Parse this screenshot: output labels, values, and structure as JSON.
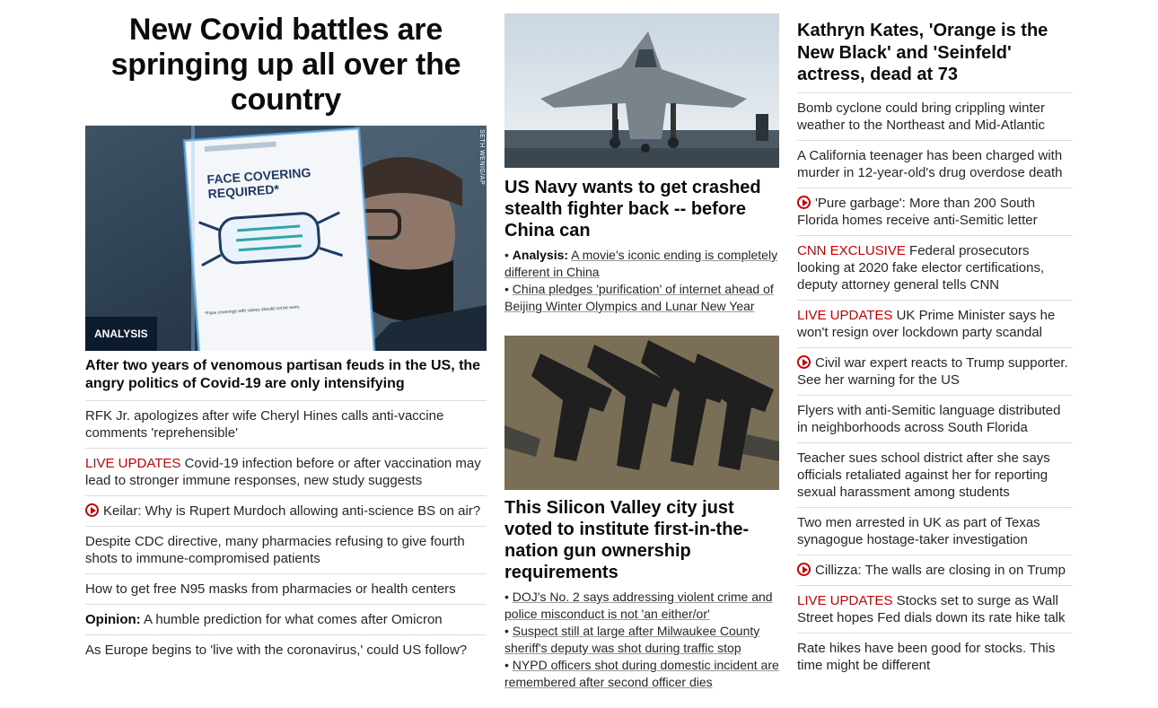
{
  "col1": {
    "title": "New Covid battles are springing up all over the country",
    "badge": "ANALYSIS",
    "credit": "SETH WENIG/AP",
    "sign_line1": "FACE COVERING",
    "sign_line2": "REQUIRED*",
    "sign_small": "*Face coverings with valves should not be worn.",
    "caption": "After two years of venomous partisan feuds in the US, the angry politics of Covid-19 are only intensifying",
    "items": [
      {
        "prefix": "",
        "text": "RFK Jr. apologizes after wife Cheryl Hines calls anti-vaccine comments 'reprehensible'"
      },
      {
        "prefix": "LIVE UPDATES",
        "text": "Covid-19 infection before or after vaccination may lead to stronger immune responses, new study suggests"
      },
      {
        "prefix": "",
        "text": "Keilar: Why is Rupert Murdoch allowing anti-science BS on air?"
      },
      {
        "prefix": "",
        "text": "Despite CDC directive, many pharmacies refusing to give fourth shots to immune-compromised patients"
      },
      {
        "prefix": "",
        "text": "How to get free N95 masks from pharmacies or health centers"
      },
      {
        "prefix": "Opinion:",
        "text": "A humble prediction for what comes after Omicron"
      },
      {
        "prefix": "",
        "text": "As Europe begins to 'live with the coronavirus,' could US follow?"
      }
    ]
  },
  "col2": {
    "story1": {
      "title": "US Navy wants to get crashed stealth fighter back -- before China can",
      "links": [
        {
          "label": "Analysis:",
          "text": "A movie's iconic ending is completely different in China"
        },
        {
          "label": "",
          "text": "China pledges 'purification' of internet ahead of Beijing Winter Olympics and Lunar New Year"
        }
      ]
    },
    "story2": {
      "title": "This Silicon Valley city just voted to institute first-in-the-nation gun ownership requirements",
      "links": [
        {
          "label": "",
          "text": "DOJ's No. 2 says addressing violent crime and police misconduct is not 'an either/or'"
        },
        {
          "label": "",
          "text": "Suspect still at large after Milwaukee County sheriff's deputy was shot during traffic stop"
        },
        {
          "label": "",
          "text": "NYPD officers shot during domestic incident are remembered after second officer dies"
        }
      ]
    },
    "bullet": "•"
  },
  "col3": {
    "title": "Kathryn Kates, 'Orange is the New Black' and 'Seinfeld' actress, dead at 73",
    "items": [
      {
        "prefix": "",
        "text": "Bomb cyclone could bring crippling winter weather to the Northeast and Mid-Atlantic"
      },
      {
        "prefix": "",
        "text": "A California teenager has been charged with murder in 12-year-old's drug overdose death"
      },
      {
        "prefix": "",
        "text": "'Pure garbage': More than 200 South Florida homes receive anti-Semitic letter"
      },
      {
        "prefix": "CNN EXCLUSIVE",
        "text": "Federal prosecutors looking at 2020 fake elector certifications, deputy attorney general tells CNN"
      },
      {
        "prefix": "LIVE UPDATES",
        "text": "UK Prime Minister says he won't resign over lockdown party scandal"
      },
      {
        "prefix": "",
        "text": "Civil war expert reacts to Trump supporter. See her warning for the US"
      },
      {
        "prefix": "",
        "text": "Flyers with anti-Semitic language distributed in neighborhoods across South Florida"
      },
      {
        "prefix": "",
        "text": "Teacher sues school district after she says officials retaliated against her for reporting sexual harassment among students"
      },
      {
        "prefix": "",
        "text": "Two men arrested in UK as part of Texas synagogue hostage-taker investigation"
      },
      {
        "prefix": "",
        "text": "Cillizza: The walls are closing in on Trump"
      },
      {
        "prefix": "LIVE UPDATES",
        "text": "Stocks set to surge as Wall Street hopes Fed dials down its rate hike talk"
      },
      {
        "prefix": "",
        "text": "Rate hikes have been good for stocks. This time might be different"
      }
    ]
  },
  "colors": {
    "live": "#cc0000",
    "badge_bg": "#0c1c2e",
    "divider": "#dddddd"
  }
}
